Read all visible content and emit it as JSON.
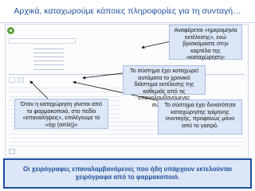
{
  "slide": {
    "title": "Αρχικά, καταχωρούμε κάποιες πληροφορίες  για τη συνταγή…"
  },
  "callouts": [
    {
      "id": "search-info",
      "text": "Αναφέρεται «ημερομηνία εκτέλεσης», ενώ βρισκόμαστε στην καρτέλα της «καταχώρηση»"
    },
    {
      "id": "repeat-period",
      "text": "Το σύστημα  έχει καταχωρεί αυτόματα το χρονικό διάστημα εκτέλεσης της καθεμιάς από τις επαναλαμβανόμενες συνταγές."
    },
    {
      "id": "pharmacist-answer",
      "text": "Όταν η καταχώρηση γίνεται από το φαρμακοποιό, στο πεδίο «επαναλήψεις», επιλέγουμε το «όχι (απλή)»"
    },
    {
      "id": "trimester",
      "text": "Το σύστημα έχει δυνατότητα καταχώρησης τρίμηνης συνταγής, προφανώς μόνο από το γιατρό."
    }
  ],
  "bottom_note": "Οι χειρόγραφες επαναλαμβανόμενες που ήδη υπάρχουν εκτελούνται χειρόγραφα από το φαρμακοποιό.",
  "colors": {
    "accent": "#1f4e9c",
    "callout_bg": "#dce6f6"
  }
}
